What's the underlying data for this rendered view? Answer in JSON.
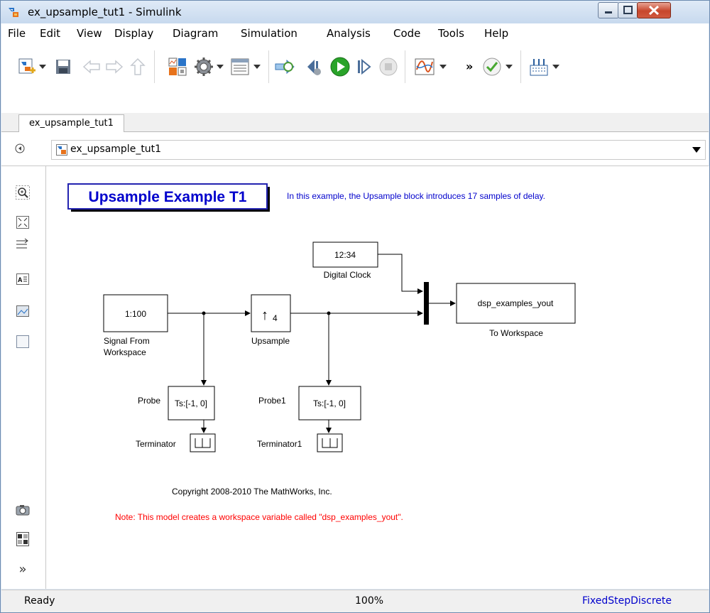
{
  "window": {
    "title": "ex_upsample_tut1 - Simulink"
  },
  "menu": [
    "File",
    "Edit",
    "View",
    "Display",
    "Diagram",
    "Simulation",
    "Analysis",
    "Code",
    "Tools",
    "Help"
  ],
  "toolbar": {
    "overflow_label": "»"
  },
  "tabs": [
    {
      "label": "ex_upsample_tut1"
    }
  ],
  "address": {
    "path": "ex_upsample_tut1"
  },
  "model": {
    "title": "Upsample Example T1",
    "description": "In this example, the Upsample block introduces 17 samples of delay.",
    "copyright": "Copyright 2008-2010 The MathWorks, Inc.",
    "note": "Note: This model creates a workspace variable called \"dsp_examples_yout\".",
    "blocks": {
      "signal_from_workspace": {
        "content": "1:100",
        "label_line1": "Signal From",
        "label_line2": "Workspace"
      },
      "upsample": {
        "arrow": "↑",
        "factor": "4",
        "label": "Upsample"
      },
      "digital_clock": {
        "content": "12:34",
        "label": "Digital Clock"
      },
      "to_workspace": {
        "content": "dsp_examples_yout",
        "label": "To Workspace"
      },
      "probe": {
        "content": "Ts:[-1, 0]",
        "label": "Probe"
      },
      "probe1": {
        "content": "Ts:[-1, 0]",
        "label": "Probe1"
      },
      "terminator": {
        "label": "Terminator"
      },
      "terminator1": {
        "label": "Terminator1"
      }
    }
  },
  "status": {
    "state": "Ready",
    "zoom": "100%",
    "solver": "FixedStepDiscrete"
  },
  "colors": {
    "title_blue": "#0000cc",
    "note_red": "#ff0000",
    "status_link": "#0000cc"
  }
}
